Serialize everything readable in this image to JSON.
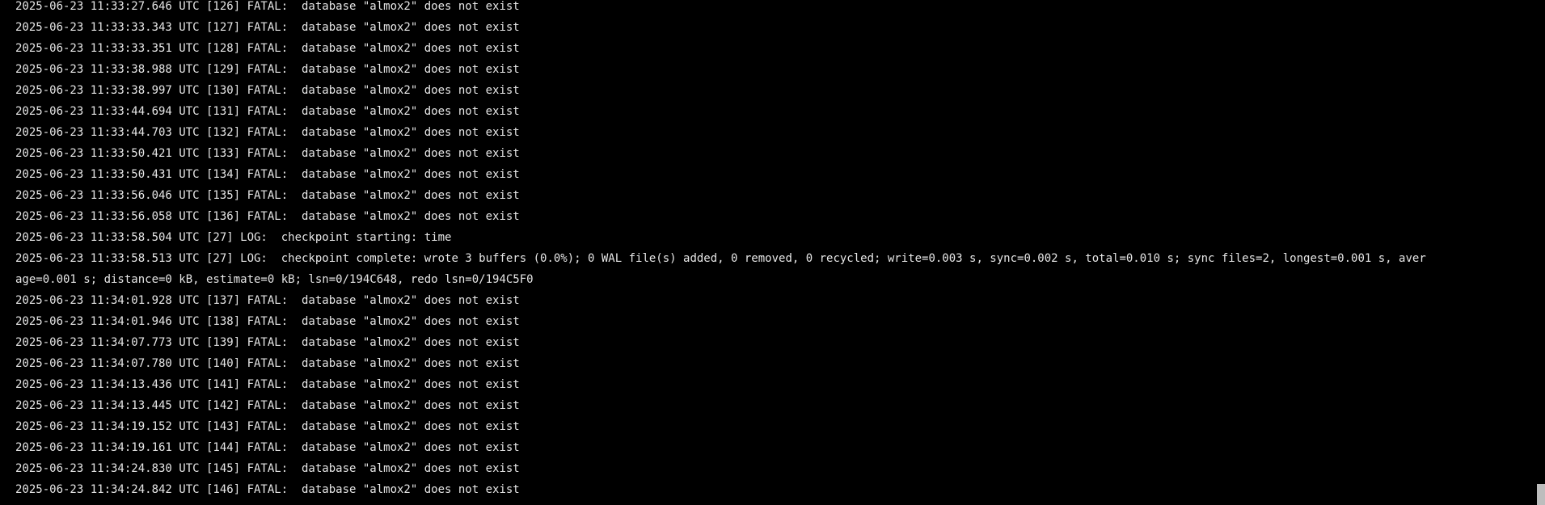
{
  "terminal": {
    "lines": [
      "2025-06-23 11:33:27.646 UTC [126] FATAL:  database \"almox2\" does not exist",
      "2025-06-23 11:33:33.343 UTC [127] FATAL:  database \"almox2\" does not exist",
      "2025-06-23 11:33:33.351 UTC [128] FATAL:  database \"almox2\" does not exist",
      "2025-06-23 11:33:38.988 UTC [129] FATAL:  database \"almox2\" does not exist",
      "2025-06-23 11:33:38.997 UTC [130] FATAL:  database \"almox2\" does not exist",
      "2025-06-23 11:33:44.694 UTC [131] FATAL:  database \"almox2\" does not exist",
      "2025-06-23 11:33:44.703 UTC [132] FATAL:  database \"almox2\" does not exist",
      "2025-06-23 11:33:50.421 UTC [133] FATAL:  database \"almox2\" does not exist",
      "2025-06-23 11:33:50.431 UTC [134] FATAL:  database \"almox2\" does not exist",
      "2025-06-23 11:33:56.046 UTC [135] FATAL:  database \"almox2\" does not exist",
      "2025-06-23 11:33:56.058 UTC [136] FATAL:  database \"almox2\" does not exist",
      "2025-06-23 11:33:58.504 UTC [27] LOG:  checkpoint starting: time",
      "2025-06-23 11:33:58.513 UTC [27] LOG:  checkpoint complete: wrote 3 buffers (0.0%); 0 WAL file(s) added, 0 removed, 0 recycled; write=0.003 s, sync=0.002 s, total=0.010 s; sync files=2, longest=0.001 s, aver",
      "age=0.001 s; distance=0 kB, estimate=0 kB; lsn=0/194C648, redo lsn=0/194C5F0",
      "2025-06-23 11:34:01.928 UTC [137] FATAL:  database \"almox2\" does not exist",
      "2025-06-23 11:34:01.946 UTC [138] FATAL:  database \"almox2\" does not exist",
      "2025-06-23 11:34:07.773 UTC [139] FATAL:  database \"almox2\" does not exist",
      "2025-06-23 11:34:07.780 UTC [140] FATAL:  database \"almox2\" does not exist",
      "2025-06-23 11:34:13.436 UTC [141] FATAL:  database \"almox2\" does not exist",
      "2025-06-23 11:34:13.445 UTC [142] FATAL:  database \"almox2\" does not exist",
      "2025-06-23 11:34:19.152 UTC [143] FATAL:  database \"almox2\" does not exist",
      "2025-06-23 11:34:19.161 UTC [144] FATAL:  database \"almox2\" does not exist",
      "2025-06-23 11:34:24.830 UTC [145] FATAL:  database \"almox2\" does not exist",
      "2025-06-23 11:34:24.842 UTC [146] FATAL:  database \"almox2\" does not exist"
    ]
  },
  "colors": {
    "background": "#000000",
    "text": "#e6e6e6",
    "scrollbar_thumb": "#bdbdbd"
  }
}
